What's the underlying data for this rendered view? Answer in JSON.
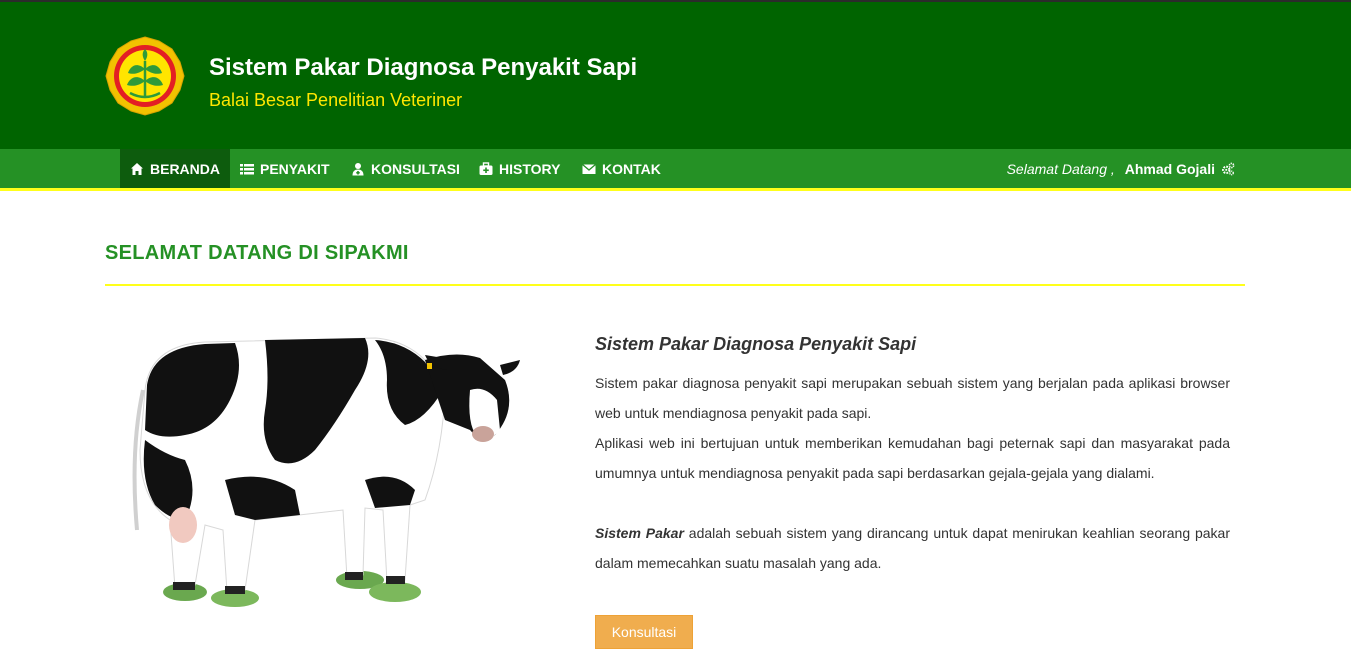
{
  "header": {
    "title": "Sistem Pakar Diagnosa Penyakit Sapi",
    "subtitle": "Balai Besar Penelitian Veteriner",
    "logo_icon": "ministry-seal-logo"
  },
  "nav": {
    "items": [
      {
        "label": "BERANDA",
        "icon": "home-icon",
        "active": true
      },
      {
        "label": "PENYAKIT",
        "icon": "list-icon",
        "active": false
      },
      {
        "label": "KONSULTASI",
        "icon": "user-md-icon",
        "active": false
      },
      {
        "label": "HISTORY",
        "icon": "medkit-icon",
        "active": false
      },
      {
        "label": "KONTAK",
        "icon": "envelope-icon",
        "active": false
      }
    ],
    "welcome_text": "Selamat Datang ,",
    "user_name": "Ahmad Gojali",
    "user_icon": "gears-icon"
  },
  "main": {
    "page_title": "SELAMAT DATANG DI SIPAKMI",
    "article_title": "Sistem Pakar Diagnosa Penyakit Sapi",
    "paragraph1": "Sistem pakar diagnosa penyakit sapi merupakan sebuah sistem yang berjalan pada aplikasi browser web untuk mendiagnosa penyakit pada sapi.",
    "paragraph2": "Aplikasi web ini bertujuan untuk memberikan kemudahan bagi peternak sapi dan masyarakat pada umumnya untuk mendiagnosa penyakit pada sapi berdasarkan gejala-gejala yang dialami.",
    "paragraph3_em": "Sistem Pakar",
    "paragraph3_rest": " adalah sebuah sistem yang dirancang untuk dapat menirukan keahlian seorang pakar dalam memecahkan suatu masalah yang ada.",
    "button_label": "Konsultasi"
  },
  "colors": {
    "header_bg": "#006400",
    "nav_bg": "#259125",
    "nav_active_bg": "#0d5c0d",
    "accent_yellow": "#ffff1a",
    "subtitle_yellow": "#ffe600",
    "button_orange": "#f0ad4e"
  }
}
